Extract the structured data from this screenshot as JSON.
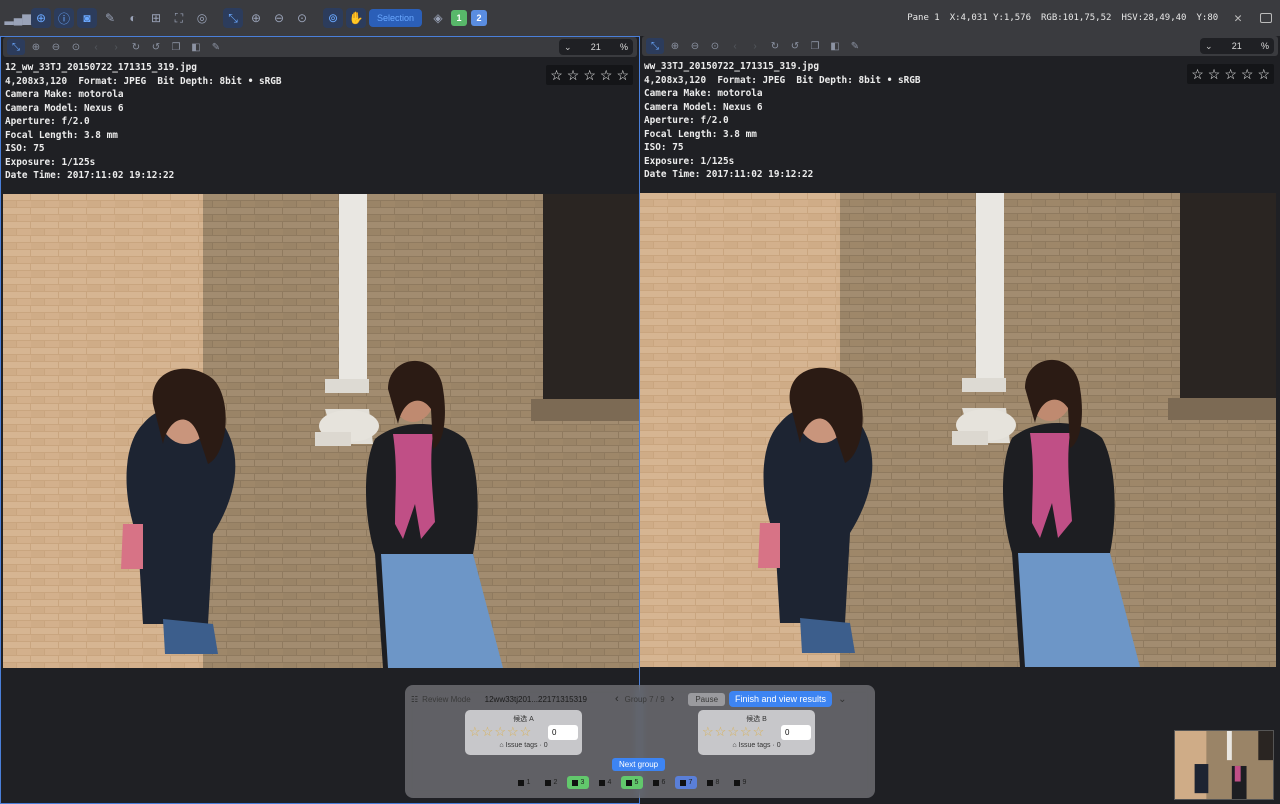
{
  "topbar": {
    "icons": [
      "histogram-icon",
      "crosshair-icon",
      "info-icon",
      "camera-icon",
      "pen-icon",
      "contrast-icon",
      "grid-icon",
      "fullscreen-icon",
      "fit-icon",
      "zoom-in-icon",
      "zoom-out-icon",
      "zoom-reset-icon",
      "zoom-icon",
      "hand-icon"
    ],
    "badge": "Selection",
    "layer_icon": "layers-icon",
    "pane_buttons": [
      "1",
      "2"
    ],
    "status": {
      "pane": "Pane 1",
      "coords": "X:4,031 Y:1,576",
      "rgb": "RGB:101,75,52",
      "hsv": "HSV:28,49,40",
      "y": "Y:80"
    }
  },
  "panes": [
    {
      "zoom": "21",
      "zoom_unit": "%",
      "meta": {
        "filename": "12_ww_33TJ_20150722_171315_319.jpg",
        "dims": "4,208x3,120  Format: JPEG  Bit Depth: 8bit • sRGB",
        "make": "Camera Make: motorola",
        "model": "Camera Model: Nexus 6",
        "aperture": "Aperture: f/2.0",
        "focal": "Focal Length: 3.8 mm",
        "iso": "ISO: 75",
        "exposure": "Exposure: 1/125s",
        "datetime": "Date Time: 2017:11:02 19:12:22"
      }
    },
    {
      "zoom": "21",
      "zoom_unit": "%",
      "meta": {
        "filename": "ww_33TJ_20150722_171315_319.jpg",
        "dims": "4,208x3,120  Format: JPEG  Bit Depth: 8bit • sRGB",
        "make": "Camera Make: motorola",
        "model": "Camera Model: Nexus 6",
        "aperture": "Aperture: f/2.0",
        "focal": "Focal Length: 3.8 mm",
        "iso": "ISO: 75",
        "exposure": "Exposure: 1/125s",
        "datetime": "Date Time: 2017:11:02 19:12:22"
      }
    }
  ],
  "review": {
    "mode_label": "Review Mode",
    "file": "12ww33tj201...22171315319",
    "group": "Group 7 / 9",
    "pause": "Pause",
    "finish": "Finish and view results",
    "candidates": [
      {
        "title": "候选 A",
        "score": "0",
        "tags": "Issue tags · 0"
      },
      {
        "title": "候选 B",
        "score": "0",
        "tags": "Issue tags · 0"
      }
    ],
    "next_group": "Next group",
    "slots": [
      {
        "label": "1",
        "state": "normal"
      },
      {
        "label": "2",
        "state": "normal"
      },
      {
        "label": "3",
        "state": "green"
      },
      {
        "label": "4",
        "state": "normal"
      },
      {
        "label": "5",
        "state": "green"
      },
      {
        "label": "6",
        "state": "normal"
      },
      {
        "label": "7",
        "state": "blue"
      },
      {
        "label": "8",
        "state": "normal"
      },
      {
        "label": "9",
        "state": "normal"
      }
    ]
  }
}
